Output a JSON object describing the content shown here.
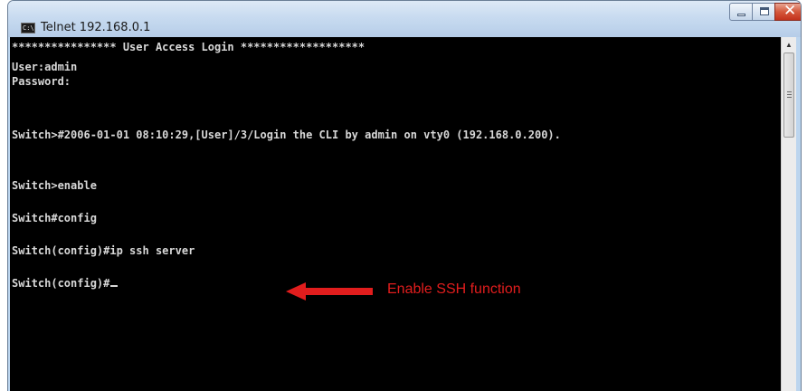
{
  "window": {
    "title": "Telnet 192.168.0.1",
    "app_icon_text": "C:\\"
  },
  "console": {
    "lines": [
      "**************** User Access Login *******************",
      "User:admin",
      "Password:",
      "Switch>#2006-01-01 08:10:29,[User]/3/Login the CLI by admin on vty0 (192.168.0.200).",
      "Switch>enable",
      "Switch#config",
      "Switch(config)#ip ssh server",
      "Switch(config)#"
    ]
  },
  "annotation": {
    "text": "Enable SSH function",
    "color": "#e11d1d"
  },
  "icons": {
    "minimize": "minimize-icon",
    "maximize": "maximize-icon",
    "close": "close-icon",
    "scroll_up": "scroll-up-arrow-icon",
    "annotation": "red-arrow-icon"
  }
}
